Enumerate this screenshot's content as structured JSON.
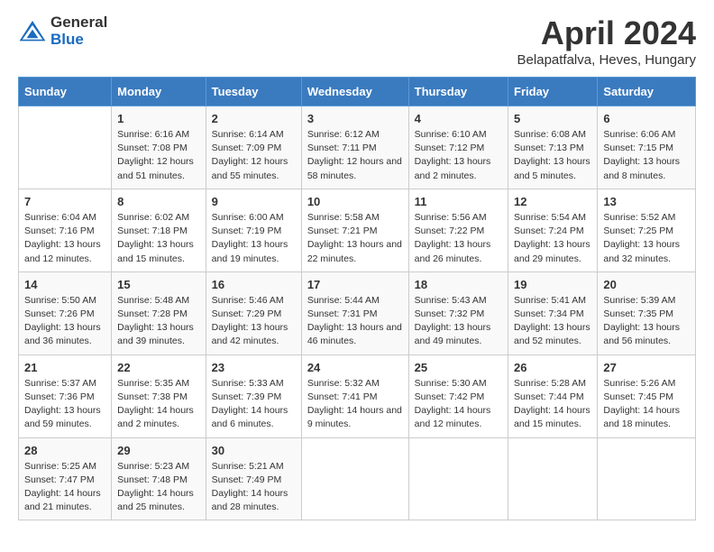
{
  "header": {
    "logo_general": "General",
    "logo_blue": "Blue",
    "main_title": "April 2024",
    "subtitle": "Belapatfalva, Heves, Hungary"
  },
  "columns": [
    "Sunday",
    "Monday",
    "Tuesday",
    "Wednesday",
    "Thursday",
    "Friday",
    "Saturday"
  ],
  "weeks": [
    [
      {
        "day": "",
        "sunrise": "",
        "sunset": "",
        "daylight": ""
      },
      {
        "day": "1",
        "sunrise": "Sunrise: 6:16 AM",
        "sunset": "Sunset: 7:08 PM",
        "daylight": "Daylight: 12 hours and 51 minutes."
      },
      {
        "day": "2",
        "sunrise": "Sunrise: 6:14 AM",
        "sunset": "Sunset: 7:09 PM",
        "daylight": "Daylight: 12 hours and 55 minutes."
      },
      {
        "day": "3",
        "sunrise": "Sunrise: 6:12 AM",
        "sunset": "Sunset: 7:11 PM",
        "daylight": "Daylight: 12 hours and 58 minutes."
      },
      {
        "day": "4",
        "sunrise": "Sunrise: 6:10 AM",
        "sunset": "Sunset: 7:12 PM",
        "daylight": "Daylight: 13 hours and 2 minutes."
      },
      {
        "day": "5",
        "sunrise": "Sunrise: 6:08 AM",
        "sunset": "Sunset: 7:13 PM",
        "daylight": "Daylight: 13 hours and 5 minutes."
      },
      {
        "day": "6",
        "sunrise": "Sunrise: 6:06 AM",
        "sunset": "Sunset: 7:15 PM",
        "daylight": "Daylight: 13 hours and 8 minutes."
      }
    ],
    [
      {
        "day": "7",
        "sunrise": "Sunrise: 6:04 AM",
        "sunset": "Sunset: 7:16 PM",
        "daylight": "Daylight: 13 hours and 12 minutes."
      },
      {
        "day": "8",
        "sunrise": "Sunrise: 6:02 AM",
        "sunset": "Sunset: 7:18 PM",
        "daylight": "Daylight: 13 hours and 15 minutes."
      },
      {
        "day": "9",
        "sunrise": "Sunrise: 6:00 AM",
        "sunset": "Sunset: 7:19 PM",
        "daylight": "Daylight: 13 hours and 19 minutes."
      },
      {
        "day": "10",
        "sunrise": "Sunrise: 5:58 AM",
        "sunset": "Sunset: 7:21 PM",
        "daylight": "Daylight: 13 hours and 22 minutes."
      },
      {
        "day": "11",
        "sunrise": "Sunrise: 5:56 AM",
        "sunset": "Sunset: 7:22 PM",
        "daylight": "Daylight: 13 hours and 26 minutes."
      },
      {
        "day": "12",
        "sunrise": "Sunrise: 5:54 AM",
        "sunset": "Sunset: 7:24 PM",
        "daylight": "Daylight: 13 hours and 29 minutes."
      },
      {
        "day": "13",
        "sunrise": "Sunrise: 5:52 AM",
        "sunset": "Sunset: 7:25 PM",
        "daylight": "Daylight: 13 hours and 32 minutes."
      }
    ],
    [
      {
        "day": "14",
        "sunrise": "Sunrise: 5:50 AM",
        "sunset": "Sunset: 7:26 PM",
        "daylight": "Daylight: 13 hours and 36 minutes."
      },
      {
        "day": "15",
        "sunrise": "Sunrise: 5:48 AM",
        "sunset": "Sunset: 7:28 PM",
        "daylight": "Daylight: 13 hours and 39 minutes."
      },
      {
        "day": "16",
        "sunrise": "Sunrise: 5:46 AM",
        "sunset": "Sunset: 7:29 PM",
        "daylight": "Daylight: 13 hours and 42 minutes."
      },
      {
        "day": "17",
        "sunrise": "Sunrise: 5:44 AM",
        "sunset": "Sunset: 7:31 PM",
        "daylight": "Daylight: 13 hours and 46 minutes."
      },
      {
        "day": "18",
        "sunrise": "Sunrise: 5:43 AM",
        "sunset": "Sunset: 7:32 PM",
        "daylight": "Daylight: 13 hours and 49 minutes."
      },
      {
        "day": "19",
        "sunrise": "Sunrise: 5:41 AM",
        "sunset": "Sunset: 7:34 PM",
        "daylight": "Daylight: 13 hours and 52 minutes."
      },
      {
        "day": "20",
        "sunrise": "Sunrise: 5:39 AM",
        "sunset": "Sunset: 7:35 PM",
        "daylight": "Daylight: 13 hours and 56 minutes."
      }
    ],
    [
      {
        "day": "21",
        "sunrise": "Sunrise: 5:37 AM",
        "sunset": "Sunset: 7:36 PM",
        "daylight": "Daylight: 13 hours and 59 minutes."
      },
      {
        "day": "22",
        "sunrise": "Sunrise: 5:35 AM",
        "sunset": "Sunset: 7:38 PM",
        "daylight": "Daylight: 14 hours and 2 minutes."
      },
      {
        "day": "23",
        "sunrise": "Sunrise: 5:33 AM",
        "sunset": "Sunset: 7:39 PM",
        "daylight": "Daylight: 14 hours and 6 minutes."
      },
      {
        "day": "24",
        "sunrise": "Sunrise: 5:32 AM",
        "sunset": "Sunset: 7:41 PM",
        "daylight": "Daylight: 14 hours and 9 minutes."
      },
      {
        "day": "25",
        "sunrise": "Sunrise: 5:30 AM",
        "sunset": "Sunset: 7:42 PM",
        "daylight": "Daylight: 14 hours and 12 minutes."
      },
      {
        "day": "26",
        "sunrise": "Sunrise: 5:28 AM",
        "sunset": "Sunset: 7:44 PM",
        "daylight": "Daylight: 14 hours and 15 minutes."
      },
      {
        "day": "27",
        "sunrise": "Sunrise: 5:26 AM",
        "sunset": "Sunset: 7:45 PM",
        "daylight": "Daylight: 14 hours and 18 minutes."
      }
    ],
    [
      {
        "day": "28",
        "sunrise": "Sunrise: 5:25 AM",
        "sunset": "Sunset: 7:47 PM",
        "daylight": "Daylight: 14 hours and 21 minutes."
      },
      {
        "day": "29",
        "sunrise": "Sunrise: 5:23 AM",
        "sunset": "Sunset: 7:48 PM",
        "daylight": "Daylight: 14 hours and 25 minutes."
      },
      {
        "day": "30",
        "sunrise": "Sunrise: 5:21 AM",
        "sunset": "Sunset: 7:49 PM",
        "daylight": "Daylight: 14 hours and 28 minutes."
      },
      {
        "day": "",
        "sunrise": "",
        "sunset": "",
        "daylight": ""
      },
      {
        "day": "",
        "sunrise": "",
        "sunset": "",
        "daylight": ""
      },
      {
        "day": "",
        "sunrise": "",
        "sunset": "",
        "daylight": ""
      },
      {
        "day": "",
        "sunrise": "",
        "sunset": "",
        "daylight": ""
      }
    ]
  ]
}
